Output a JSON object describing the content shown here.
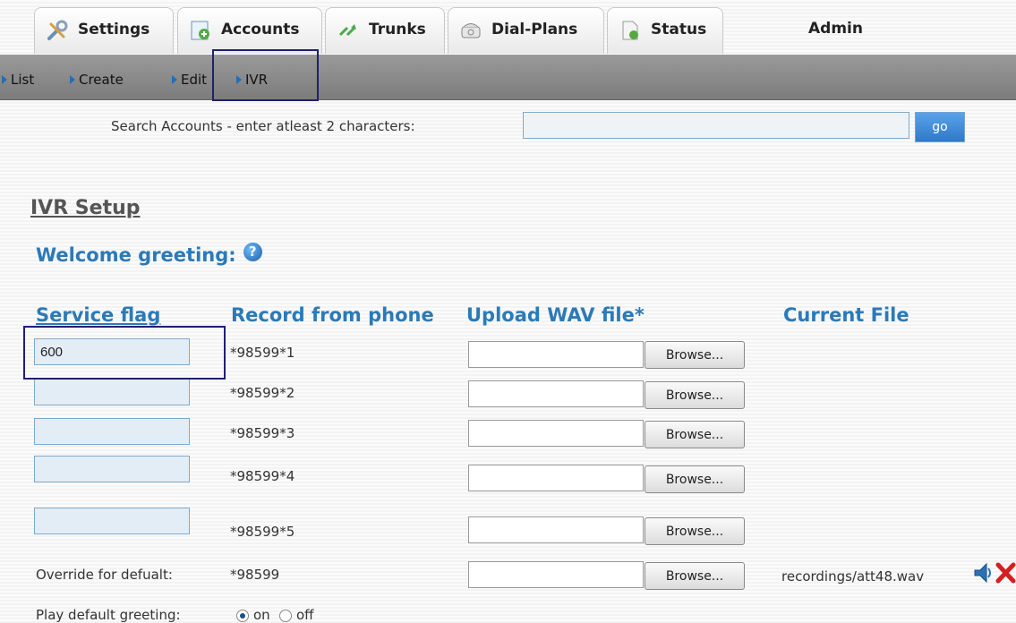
{
  "tabs": [
    {
      "label": "Settings",
      "icon": "tools-icon"
    },
    {
      "label": "Accounts",
      "icon": "accounts-icon"
    },
    {
      "label": "Trunks",
      "icon": "trunks-icon"
    },
    {
      "label": "Dial-Plans",
      "icon": "phone-icon"
    },
    {
      "label": "Status",
      "icon": "status-icon"
    }
  ],
  "admin_label": "Admin",
  "subnav": {
    "items": [
      "List",
      "Create",
      "Edit",
      "IVR"
    ]
  },
  "search": {
    "label": "Search Accounts - enter atleast 2 characters:",
    "value": "",
    "go_label": "go"
  },
  "ivr": {
    "title": "IVR Setup",
    "welcome_label": "Welcome greeting:",
    "help_icon": "?",
    "headers": {
      "service_flag": "Service flag",
      "record_from_phone": "Record from phone",
      "upload_wav": "Upload WAV file*",
      "current_file": "Current File"
    },
    "rows": [
      {
        "flag": "600",
        "code": "*98599*1",
        "browse": "Browse..."
      },
      {
        "flag": "",
        "code": "*98599*2",
        "browse": "Browse..."
      },
      {
        "flag": "",
        "code": "*98599*3",
        "browse": "Browse..."
      },
      {
        "flag": "",
        "code": "*98599*4",
        "browse": "Browse..."
      },
      {
        "flag": "",
        "code": "*98599*5",
        "browse": "Browse..."
      }
    ],
    "override": {
      "label": "Override for defualt:",
      "code": "*98599",
      "browse": "Browse...",
      "current_file": "recordings/att48.wav"
    },
    "play_default": {
      "label": "Play default greeting:",
      "on_label": "on",
      "off_label": "off",
      "selected": "on"
    }
  },
  "colors": {
    "accent_blue": "#2b7ab8",
    "nav_bar": "#8a8a8a",
    "highlight_box": "#20206e",
    "delete_red": "#d42020"
  }
}
